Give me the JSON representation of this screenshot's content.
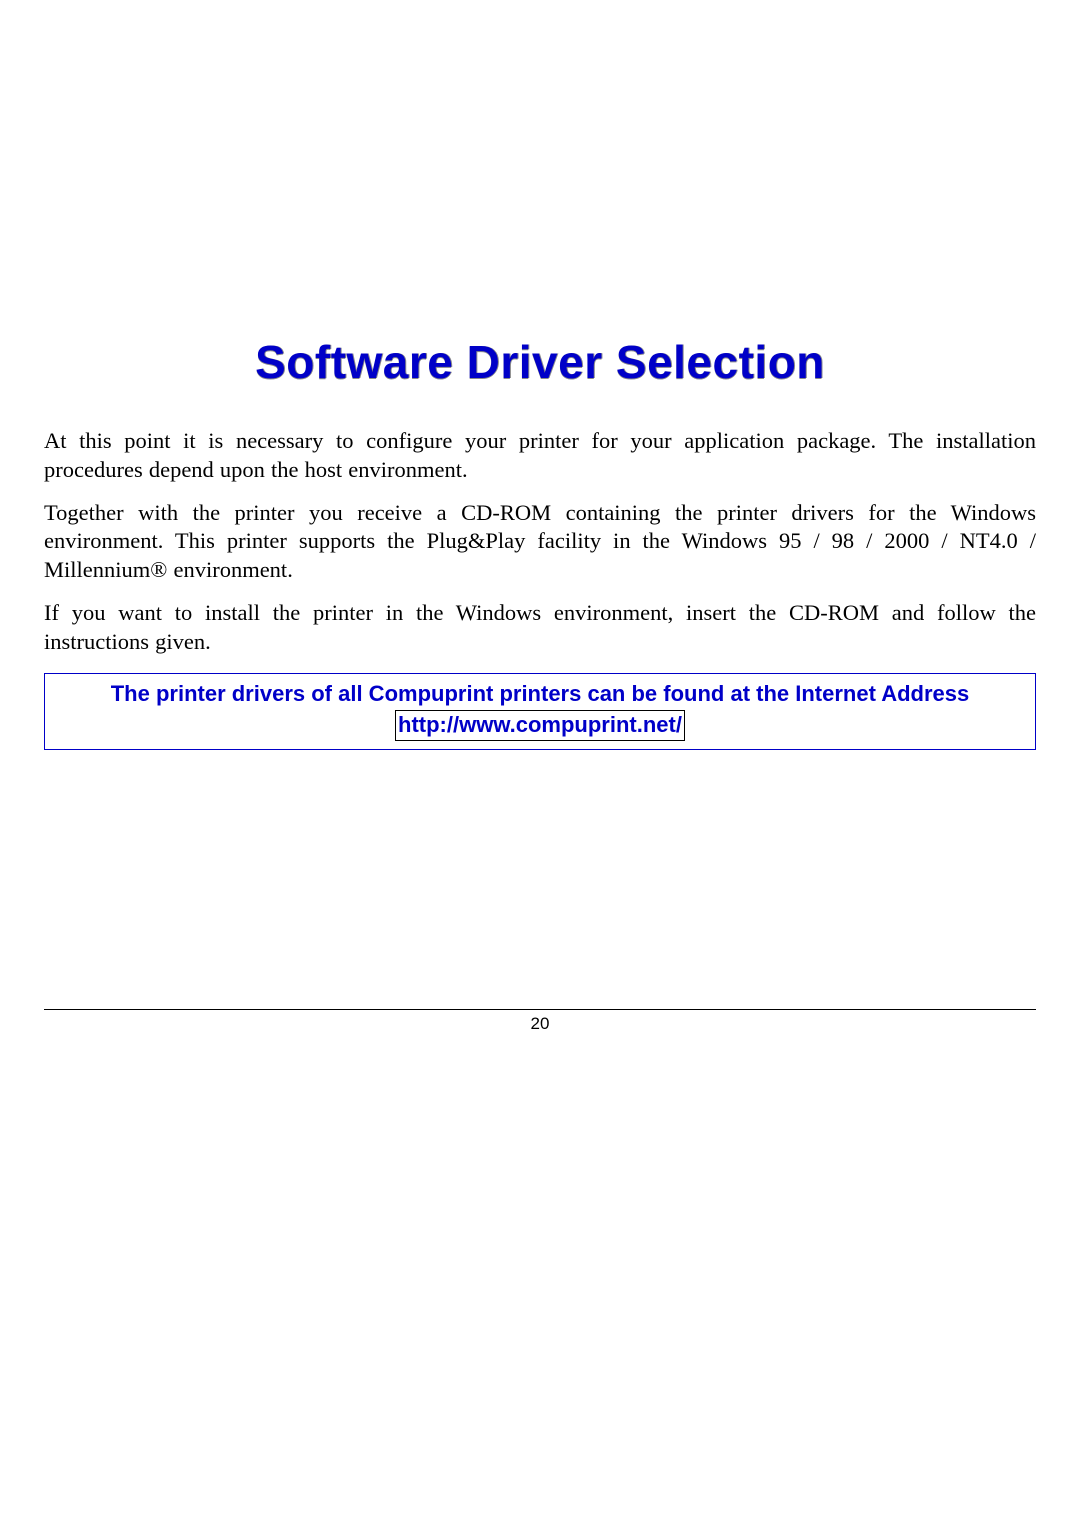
{
  "title": "Software Driver Selection",
  "paragraphs": {
    "p1": "At this point it is necessary to configure your printer for your application package. The installation procedures depend upon the host environment.",
    "p2": "Together with the printer you receive a CD-ROM containing the printer drivers for the Windows environment. This printer supports the Plug&Play facility in the Windows 95 / 98 / 2000 / NT4.0 / Millennium® environment.",
    "p3": "If you want to install the printer in the Windows environment, insert the CD-ROM and follow the instructions given."
  },
  "notice": {
    "line1": "The printer drivers of all Compuprint printers can be found at the Internet Address",
    "link": "http://www.compuprint.net/"
  },
  "page_number": "20"
}
